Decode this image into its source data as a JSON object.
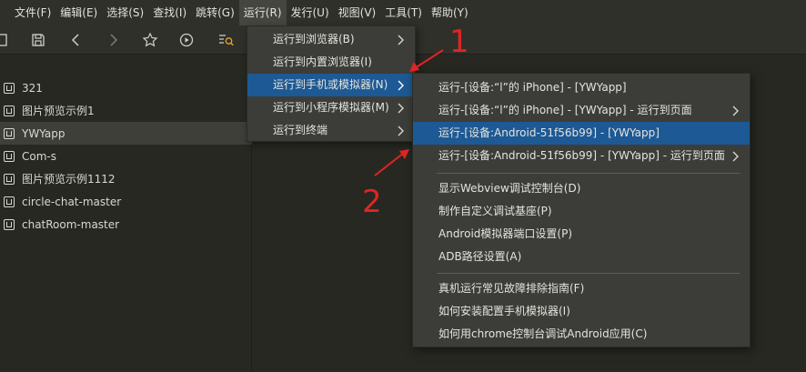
{
  "menubar": {
    "items": [
      {
        "label": "文件(F)"
      },
      {
        "label": "编辑(E)"
      },
      {
        "label": "选择(S)"
      },
      {
        "label": "查找(I)"
      },
      {
        "label": "跳转(G)"
      },
      {
        "label": "运行(R)",
        "active": true
      },
      {
        "label": "发行(U)"
      },
      {
        "label": "视图(V)"
      },
      {
        "label": "工具(T)"
      },
      {
        "label": "帮助(Y)"
      }
    ]
  },
  "toolbar": {
    "icons": [
      "close-doc-icon",
      "save-icon",
      "back-icon",
      "forward-icon",
      "star-icon",
      "run-icon",
      "search-list-icon"
    ]
  },
  "projects": [
    {
      "name": "321"
    },
    {
      "name": "图片预览示例1"
    },
    {
      "name": "YWYapp",
      "selected": true
    },
    {
      "name": "Com-s"
    },
    {
      "name": "图片预览示例1112"
    },
    {
      "name": "circle-chat-master"
    },
    {
      "name": "chatRoom-master"
    }
  ],
  "run_menu": {
    "items": [
      {
        "label": "运行到浏览器(B)",
        "has_submenu": true
      },
      {
        "label": "运行到内置浏览器(I)",
        "has_submenu": false
      },
      {
        "label": "运行到手机或模拟器(N)",
        "has_submenu": true,
        "highlighted": true
      },
      {
        "label": "运行到小程序模拟器(M)",
        "has_submenu": true
      },
      {
        "label": "运行到终端",
        "has_submenu": true
      }
    ]
  },
  "device_menu": {
    "group1": [
      {
        "label": "运行-[设备:“l”的 iPhone] - [YWYapp]",
        "has_submenu": false
      },
      {
        "label": "运行-[设备:“l”的 iPhone] - [YWYapp] - 运行到页面",
        "has_submenu": true
      },
      {
        "label": "运行-[设备:Android-51f56b99] - [YWYapp]",
        "has_submenu": false,
        "highlighted": true
      },
      {
        "label": "运行-[设备:Android-51f56b99] - [YWYapp] - 运行到页面",
        "has_submenu": true
      }
    ],
    "group2": [
      {
        "label": "显示Webview调试控制台(D)"
      },
      {
        "label": "制作自定义调试基座(P)"
      },
      {
        "label": "Android模拟器端口设置(P)"
      },
      {
        "label": "ADB路径设置(A)"
      }
    ],
    "group3": [
      {
        "label": "真机运行常见故障排除指南(F)"
      },
      {
        "label": "如何安装配置手机模拟器(I)"
      },
      {
        "label": "如何用chrome控制台调试Android应用(C)"
      }
    ]
  },
  "annotations": {
    "label_1": "1",
    "label_2": "2",
    "color": "#e02424"
  },
  "colors": {
    "highlight": "#1d5994",
    "menu_bg": "#3c3d38",
    "editor_bg": "#272822"
  }
}
